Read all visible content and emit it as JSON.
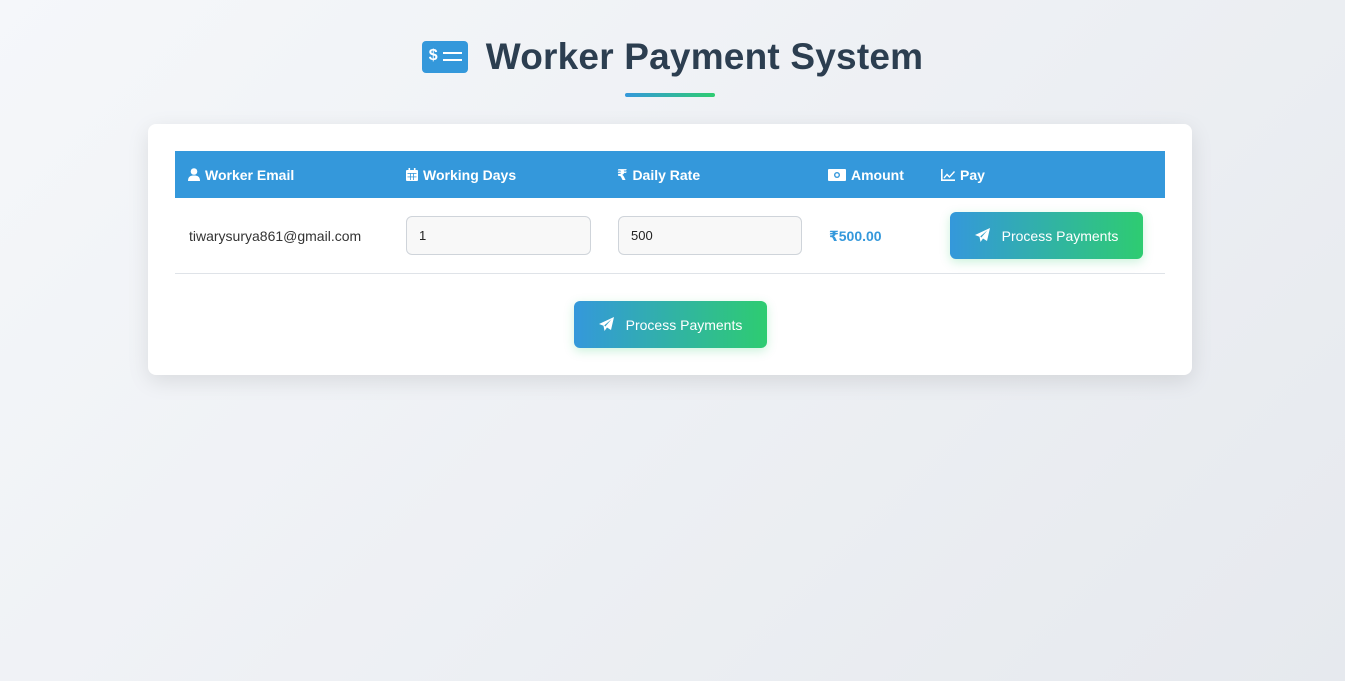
{
  "header": {
    "title": "Worker Payment System",
    "logo_icon": "money-check-dollar-icon",
    "logo_glyph": "$"
  },
  "colors": {
    "primary": "#3498db",
    "accent": "#2ecc71",
    "title": "#2c3e50"
  },
  "table": {
    "columns": [
      {
        "label": "Worker Email",
        "icon": "user-icon"
      },
      {
        "label": "Working Days",
        "icon": "calendar-icon"
      },
      {
        "label": "Daily Rate",
        "icon": "rupee-icon"
      },
      {
        "label": "Amount",
        "icon": "money-bill-icon"
      },
      {
        "label": "Pay",
        "icon": "chart-line-icon"
      }
    ],
    "rows": [
      {
        "email": "tiwarysurya861@gmail.com",
        "working_days": "1",
        "daily_rate": "500",
        "amount": "₹500.00",
        "pay_label": "Process Payments"
      }
    ]
  },
  "footer": {
    "process_label": "Process Payments"
  }
}
